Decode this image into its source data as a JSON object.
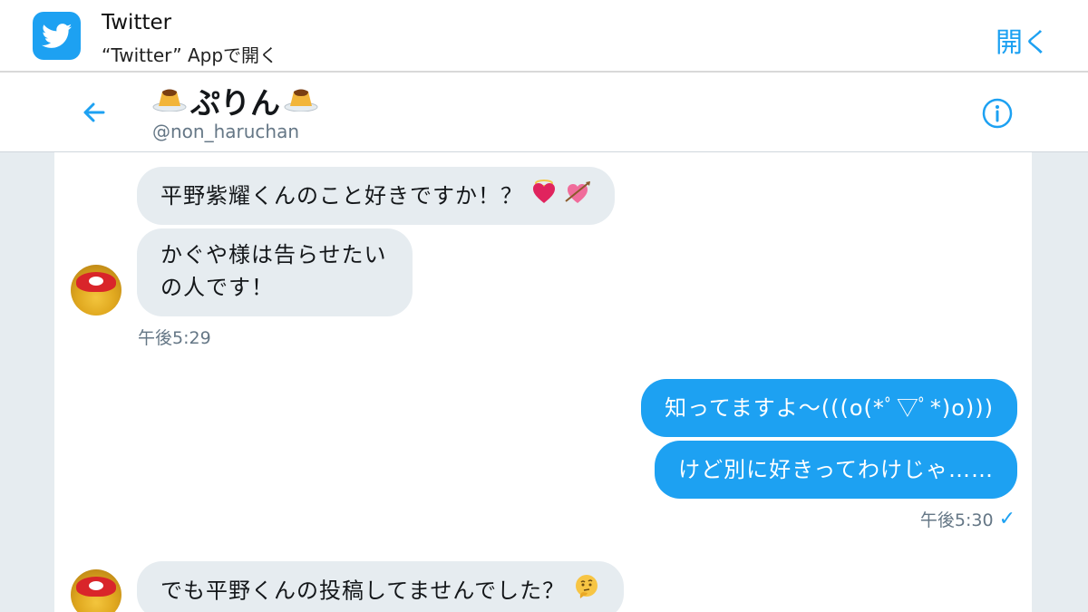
{
  "banner": {
    "app_name": "Twitter",
    "subtitle": "“Twitter” Appで開く",
    "open_label": "開く",
    "icon": "twitter-bird-icon"
  },
  "header": {
    "name": "ぷりん",
    "handle": "@non_haruchan",
    "name_decoration_icon": "pudding-icon",
    "back_icon": "back-arrow-icon",
    "info_icon": "info-icon"
  },
  "messages": [
    {
      "side": "in",
      "text": "平野紫耀くんのこと好きですか！？",
      "emojis": [
        "heart-with-halo-icon",
        "heart-with-arrow-icon"
      ]
    },
    {
      "side": "in",
      "text": "かぐや様は告らせたいの人です！"
    },
    {
      "side": "in_time",
      "text": "午後5:29"
    },
    {
      "side": "out",
      "text": "知ってますよ〜(((o(*ﾟ▽ﾟ*)o)))"
    },
    {
      "side": "out",
      "text": "けど別に好きってわけじゃ……"
    },
    {
      "side": "out_time",
      "text": "午後5:30"
    },
    {
      "side": "in",
      "text": "でも平野くんの投稿してませんでした？",
      "emojis": [
        "thinking-face-icon"
      ]
    }
  ],
  "message_lines": {
    "in2_line1": "かぐや様は告らせたい",
    "in2_line2": "の人です！"
  },
  "colors": {
    "accent": "#1da1f2",
    "incoming_bubble": "#e6ecf0",
    "muted_text": "#657786"
  }
}
